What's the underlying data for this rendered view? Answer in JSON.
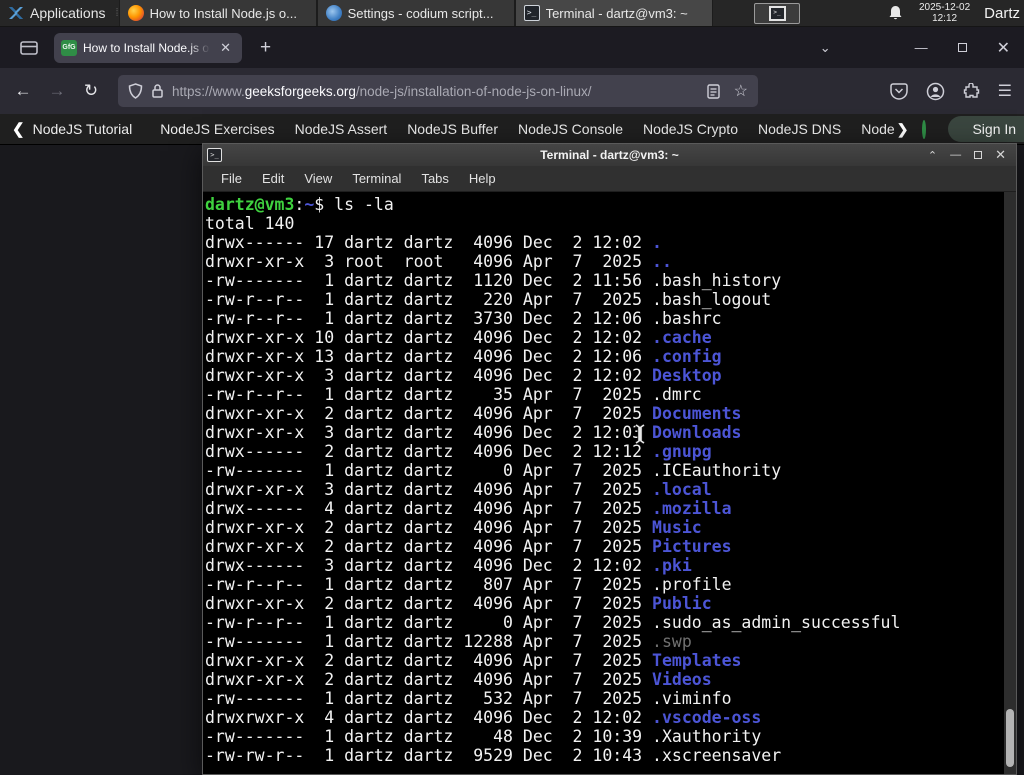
{
  "panel": {
    "applications": "Applications",
    "windows": [
      {
        "icon": "firefox",
        "label": "How to Install Node.js o..."
      },
      {
        "icon": "codium",
        "label": "Settings - codium script..."
      },
      {
        "icon": "terminal",
        "label": "Terminal - dartz@vm3: ~"
      }
    ],
    "clock": {
      "date": "2025-12-02",
      "time": "12:12"
    },
    "user": "Dartz"
  },
  "browser": {
    "tab_title": "How to Install Node.js on",
    "favicon_text": "GfG",
    "url": {
      "scheme": "https://www.",
      "domain": "geeksforgeeks.org",
      "path": "/node-js/installation-of-node-js-on-linux/"
    }
  },
  "site_nav": {
    "items": [
      "NodeJS Tutorial",
      "NodeJS Exercises",
      "NodeJS Assert",
      "NodeJS Buffer",
      "NodeJS Console",
      "NodeJS Crypto",
      "NodeJS DNS",
      "Node"
    ],
    "sign_in": "Sign In"
  },
  "terminal": {
    "title": "Terminal - dartz@vm3: ~",
    "menu": [
      "File",
      "Edit",
      "View",
      "Terminal",
      "Tabs",
      "Help"
    ],
    "prompt": {
      "user_host": "dartz@vm3",
      "colon": ":",
      "cwd": "~",
      "rest": "$ ls -la"
    },
    "total": "total 140",
    "listing": [
      {
        "meta": "drwx------ 17 dartz dartz  4096 Dec  2 12:02 ",
        "name": ".",
        "color": "dir"
      },
      {
        "meta": "drwxr-xr-x  3 root  root   4096 Apr  7  2025 ",
        "name": "..",
        "color": "dir"
      },
      {
        "meta": "-rw-------  1 dartz dartz  1120 Dec  2 11:56 ",
        "name": ".bash_history",
        "color": "file"
      },
      {
        "meta": "-rw-r--r--  1 dartz dartz   220 Apr  7  2025 ",
        "name": ".bash_logout",
        "color": "file"
      },
      {
        "meta": "-rw-r--r--  1 dartz dartz  3730 Dec  2 12:06 ",
        "name": ".bashrc",
        "color": "file"
      },
      {
        "meta": "drwxr-xr-x 10 dartz dartz  4096 Dec  2 12:02 ",
        "name": ".cache",
        "color": "dir"
      },
      {
        "meta": "drwxr-xr-x 13 dartz dartz  4096 Dec  2 12:06 ",
        "name": ".config",
        "color": "dir"
      },
      {
        "meta": "drwxr-xr-x  3 dartz dartz  4096 Dec  2 12:02 ",
        "name": "Desktop",
        "color": "dir"
      },
      {
        "meta": "-rw-r--r--  1 dartz dartz    35 Apr  7  2025 ",
        "name": ".dmrc",
        "color": "file"
      },
      {
        "meta": "drwxr-xr-x  2 dartz dartz  4096 Apr  7  2025 ",
        "name": "Documents",
        "color": "dir"
      },
      {
        "meta": "drwxr-xr-x  3 dartz dartz  4096 Dec  2 12:03 ",
        "name": "Downloads",
        "color": "dir"
      },
      {
        "meta": "drwx------  2 dartz dartz  4096 Dec  2 12:12 ",
        "name": ".gnupg",
        "color": "dir"
      },
      {
        "meta": "-rw-------  1 dartz dartz     0 Apr  7  2025 ",
        "name": ".ICEauthority",
        "color": "file"
      },
      {
        "meta": "drwxr-xr-x  3 dartz dartz  4096 Apr  7  2025 ",
        "name": ".local",
        "color": "dir"
      },
      {
        "meta": "drwx------  4 dartz dartz  4096 Apr  7  2025 ",
        "name": ".mozilla",
        "color": "dir"
      },
      {
        "meta": "drwxr-xr-x  2 dartz dartz  4096 Apr  7  2025 ",
        "name": "Music",
        "color": "dir"
      },
      {
        "meta": "drwxr-xr-x  2 dartz dartz  4096 Apr  7  2025 ",
        "name": "Pictures",
        "color": "dir"
      },
      {
        "meta": "drwx------  3 dartz dartz  4096 Dec  2 12:02 ",
        "name": ".pki",
        "color": "dir"
      },
      {
        "meta": "-rw-r--r--  1 dartz dartz   807 Apr  7  2025 ",
        "name": ".profile",
        "color": "file"
      },
      {
        "meta": "drwxr-xr-x  2 dartz dartz  4096 Apr  7  2025 ",
        "name": "Public",
        "color": "dir"
      },
      {
        "meta": "-rw-r--r--  1 dartz dartz     0 Apr  7  2025 ",
        "name": ".sudo_as_admin_successful",
        "color": "file"
      },
      {
        "meta": "-rw-------  1 dartz dartz 12288 Apr  7  2025 ",
        "name": ".swp",
        "color": "dim"
      },
      {
        "meta": "drwxr-xr-x  2 dartz dartz  4096 Apr  7  2025 ",
        "name": "Templates",
        "color": "dir"
      },
      {
        "meta": "drwxr-xr-x  2 dartz dartz  4096 Apr  7  2025 ",
        "name": "Videos",
        "color": "dir"
      },
      {
        "meta": "-rw-------  1 dartz dartz   532 Apr  7  2025 ",
        "name": ".viminfo",
        "color": "file"
      },
      {
        "meta": "drwxrwxr-x  4 dartz dartz  4096 Dec  2 12:02 ",
        "name": ".vscode-oss",
        "color": "dir"
      },
      {
        "meta": "-rw-------  1 dartz dartz    48 Dec  2 10:39 ",
        "name": ".Xauthority",
        "color": "file"
      },
      {
        "meta": "-rw-rw-r--  1 dartz dartz  9529 Dec  2 10:43 ",
        "name": ".xscreensaver",
        "color": "file"
      }
    ]
  },
  "colors": {
    "gfg_green": "#2f8d46",
    "terminal_blue": "#4c55d6",
    "terminal_green": "#3fd23f",
    "firefox_toolbar": "#2b2a33",
    "panel_bg": "#262626"
  }
}
